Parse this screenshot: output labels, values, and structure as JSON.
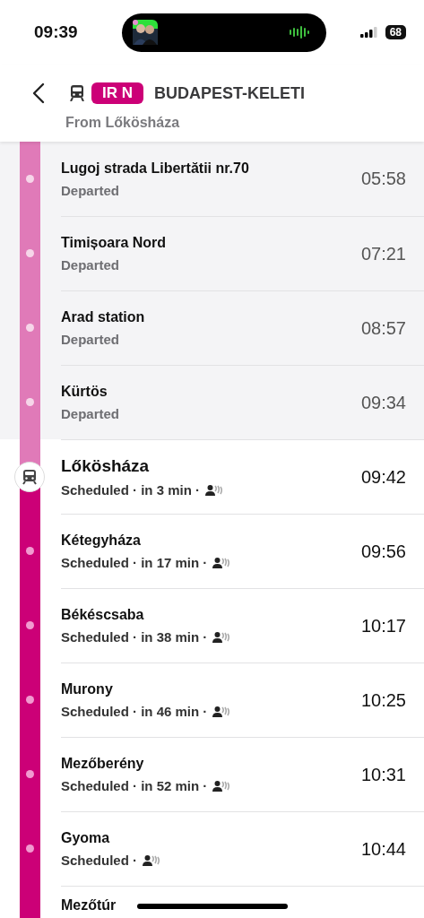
{
  "status_bar": {
    "time": "09:39",
    "battery": "68"
  },
  "header": {
    "line_badge": "IR N",
    "destination": "BUDAPEST-KELETI",
    "subtitle": "From Lőkösháza"
  },
  "stops": [
    {
      "kind": "past",
      "name": "Lugoj strada Libertătii nr.70",
      "status": "Departed",
      "time": "05:58"
    },
    {
      "kind": "past",
      "name": "Timișoara Nord",
      "status": "Departed",
      "time": "07:21"
    },
    {
      "kind": "past",
      "name": "Arad station",
      "status": "Departed",
      "time": "08:57"
    },
    {
      "kind": "past",
      "name": "Kürtös",
      "status": "Departed",
      "time": "09:34"
    },
    {
      "kind": "current",
      "name": "Lőkösháza",
      "status": "Scheduled · in 3 min ·",
      "occupancy": true,
      "time": "09:42"
    },
    {
      "kind": "future",
      "name": "Kétegyháza",
      "status": "Scheduled · in 17 min ·",
      "occupancy": true,
      "time": "09:56"
    },
    {
      "kind": "future",
      "name": "Békéscsaba",
      "status": "Scheduled · in 38 min ·",
      "occupancy": true,
      "time": "10:17"
    },
    {
      "kind": "future",
      "name": "Murony",
      "status": "Scheduled · in 46 min ·",
      "occupancy": true,
      "time": "10:25"
    },
    {
      "kind": "future",
      "name": "Mezőberény",
      "status": "Scheduled · in 52 min ·",
      "occupancy": true,
      "time": "10:31"
    },
    {
      "kind": "future",
      "name": "Gyoma",
      "status": "Scheduled ·",
      "occupancy": true,
      "time": "10:44"
    },
    {
      "kind": "future",
      "name": "Mezőtúr"
    }
  ]
}
